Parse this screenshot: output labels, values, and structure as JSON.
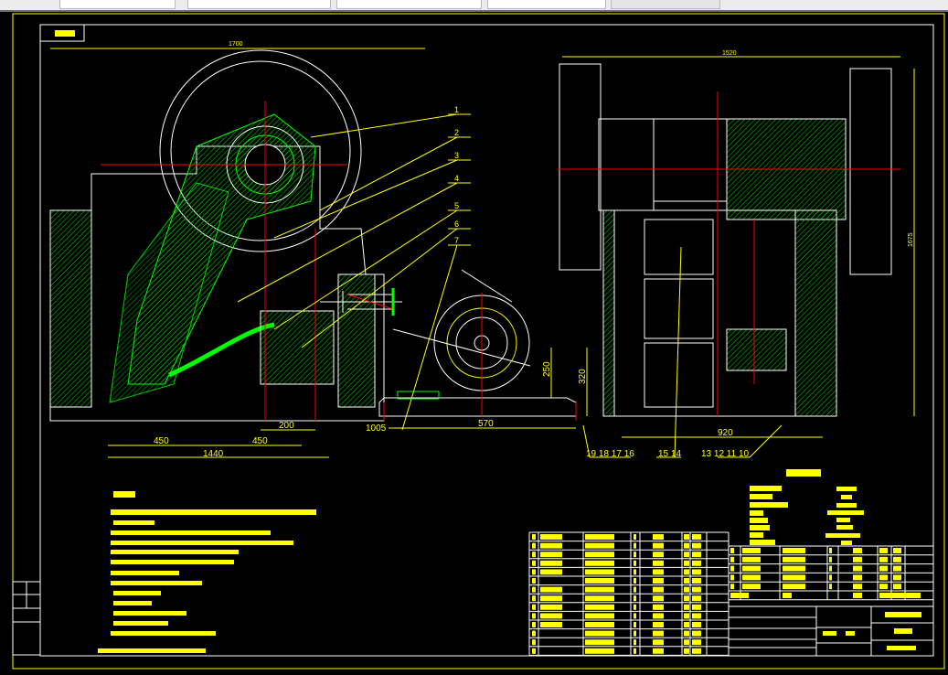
{
  "colors": {
    "background": "#000000",
    "frame": "#ffff00",
    "outline": "#ffffff",
    "centerline": "#ff0000",
    "hatch": "#00ff00"
  },
  "dimensions": {
    "top_left_width": "1700",
    "top_right_width": "1520",
    "overall_height": "1675",
    "base_length": "1440",
    "span_left": "450",
    "span_right": "450",
    "offset_small": "200",
    "motor_offset": "1005",
    "motor_base": "570",
    "motor_height": "250",
    "base_height": "320",
    "right_base": "920"
  },
  "balloons": {
    "parts_left": [
      "1",
      "2",
      "3",
      "4",
      "5",
      "6",
      "7"
    ],
    "group_a": "19 18 17 16",
    "group_b": "15 14",
    "group_c": "13 12 11 10"
  }
}
